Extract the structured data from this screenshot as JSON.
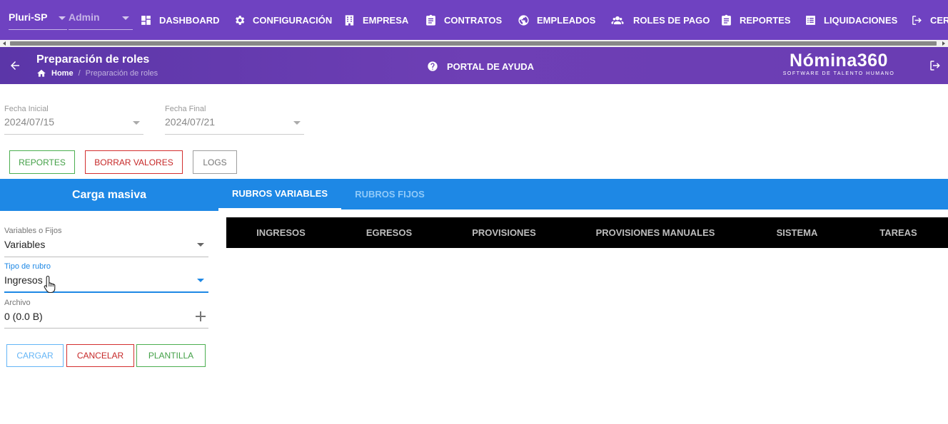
{
  "topnav": {
    "company": "Pluri-SP",
    "role": "Admin",
    "items": [
      {
        "label": "DASHBOARD",
        "icon": "dashboard-icon"
      },
      {
        "label": "CONFIGURACIÓN",
        "icon": "gear-icon"
      },
      {
        "label": "EMPRESA",
        "icon": "building-icon"
      },
      {
        "label": "CONTRATOS",
        "icon": "clipboard-icon"
      },
      {
        "label": "EMPLEADOS",
        "icon": "globe-icon"
      },
      {
        "label": "ROLES DE PAGO",
        "icon": "users-icon"
      },
      {
        "label": "REPORTES",
        "icon": "clipboard-icon"
      },
      {
        "label": "LIQUIDACIONES",
        "icon": "list-icon"
      },
      {
        "label": "CER",
        "icon": "logout-icon"
      }
    ]
  },
  "header": {
    "title": "Preparación de roles",
    "breadcrumb_home": "Home",
    "breadcrumb_separator": "/",
    "breadcrumb_current": "Preparación de roles",
    "help": "PORTAL DE AYUDA",
    "logo_brand": "Nómina360",
    "logo_tagline": "SOFTWARE DE TALENTO HUMANO"
  },
  "dates": {
    "start_label": "Fecha Inicial",
    "start_value": "2024/07/15",
    "end_label": "Fecha Final",
    "end_value": "2024/07/21"
  },
  "actions": {
    "reportes": "REPORTES",
    "borrar": "BORRAR VALORES",
    "logs": "LOGS"
  },
  "panel": {
    "title": "Carga masiva",
    "type_label": "Variables o Fijos",
    "type_value": "Variables",
    "rubro_label": "Tipo de rubro",
    "rubro_value": "Ingresos",
    "file_label": "Archivo",
    "file_value": "0 (0.0 B)",
    "cargar": "CARGAR",
    "cancelar": "CANCELAR",
    "plantilla": "PLANTILLA"
  },
  "tabs": {
    "variables": "RUBROS VARIABLES",
    "fijos": "RUBROS FIJOS"
  },
  "subtabs": {
    "ingresos": "INGRESOS",
    "egresos": "EGRESOS",
    "provisiones": "PROVISIONES",
    "provisiones_manuales": "PROVISIONES MANUALES",
    "sistema": "SISTEMA",
    "tareas": "TAREAS"
  },
  "colors": {
    "nav_purple": "#6f42c1",
    "tab_blue": "#1e88e5",
    "subtab_black": "#000000"
  }
}
